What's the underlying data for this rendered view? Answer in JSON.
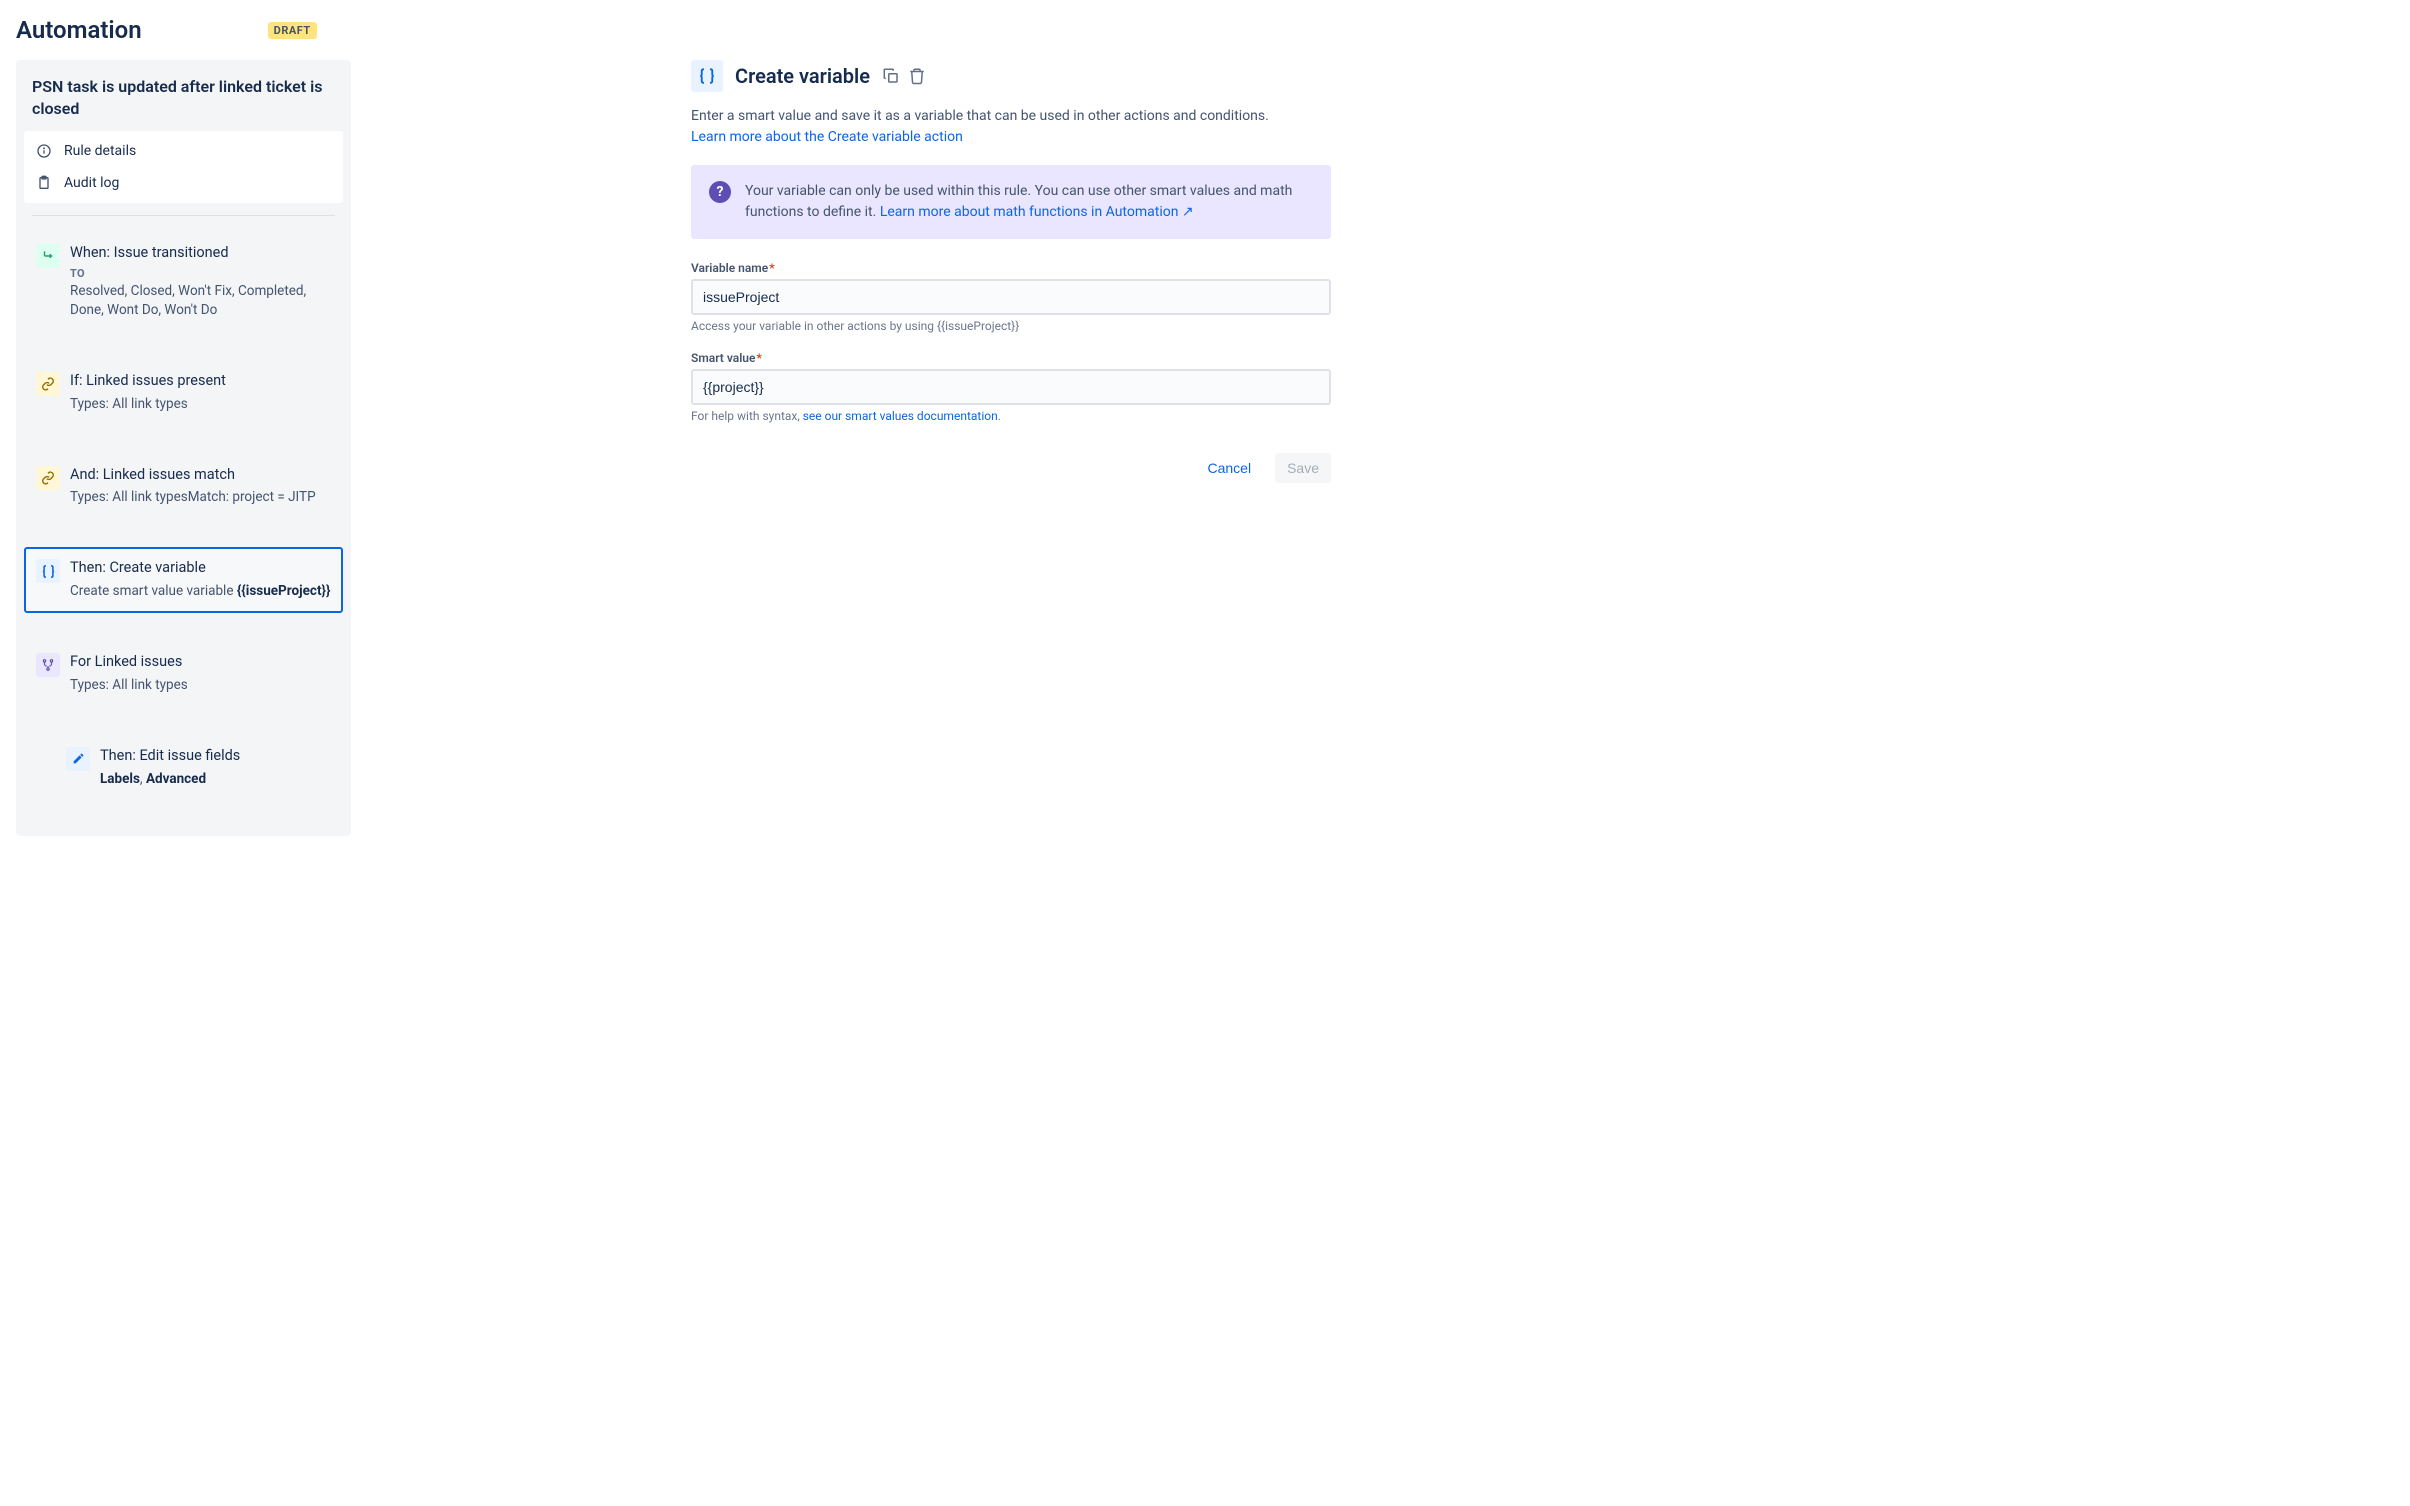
{
  "header": {
    "title": "Automation",
    "badge": "DRAFT"
  },
  "sidebar": {
    "rule_name": "PSN task is updated after linked ticket is closed",
    "rule_details": "Rule details",
    "audit_log": "Audit log",
    "steps": [
      {
        "title": "When: Issue transitioned",
        "sublabel": "TO",
        "desc": "Resolved, Closed, Won't Fix, Completed, Done, Wont Do, Won't Do"
      },
      {
        "title": "If: Linked issues present",
        "desc": "Types: All link types"
      },
      {
        "title": "And: Linked issues match",
        "desc": "Types: All link typesMatch: project = JITP"
      },
      {
        "title": "Then: Create variable",
        "desc_a": "Create smart value variable ",
        "desc_b": "{{issueProject}}"
      },
      {
        "title": "For Linked issues",
        "desc": "Types: All link types"
      },
      {
        "title": "Then: Edit issue fields",
        "desc_a": "Labels",
        "desc_sep": ", ",
        "desc_b": "Advanced"
      }
    ]
  },
  "detail": {
    "title": "Create variable",
    "desc": "Enter a smart value and save it as a variable that can be used in other actions and conditions.",
    "learn_link": "Learn more about the Create variable action",
    "info_text": "Your variable can only be used within this rule. You can use other smart values and math functions to define it. ",
    "info_link": "Learn more about math functions in Automation",
    "var_label": "Variable name",
    "var_value": "issueProject",
    "var_help": "Access your variable in other actions by using {{issueProject}}",
    "smart_label": "Smart value",
    "smart_value": "{{project}}",
    "smart_help_a": "For help with syntax, ",
    "smart_help_link": "see our smart values documentation",
    "cancel": "Cancel",
    "save": "Save"
  }
}
